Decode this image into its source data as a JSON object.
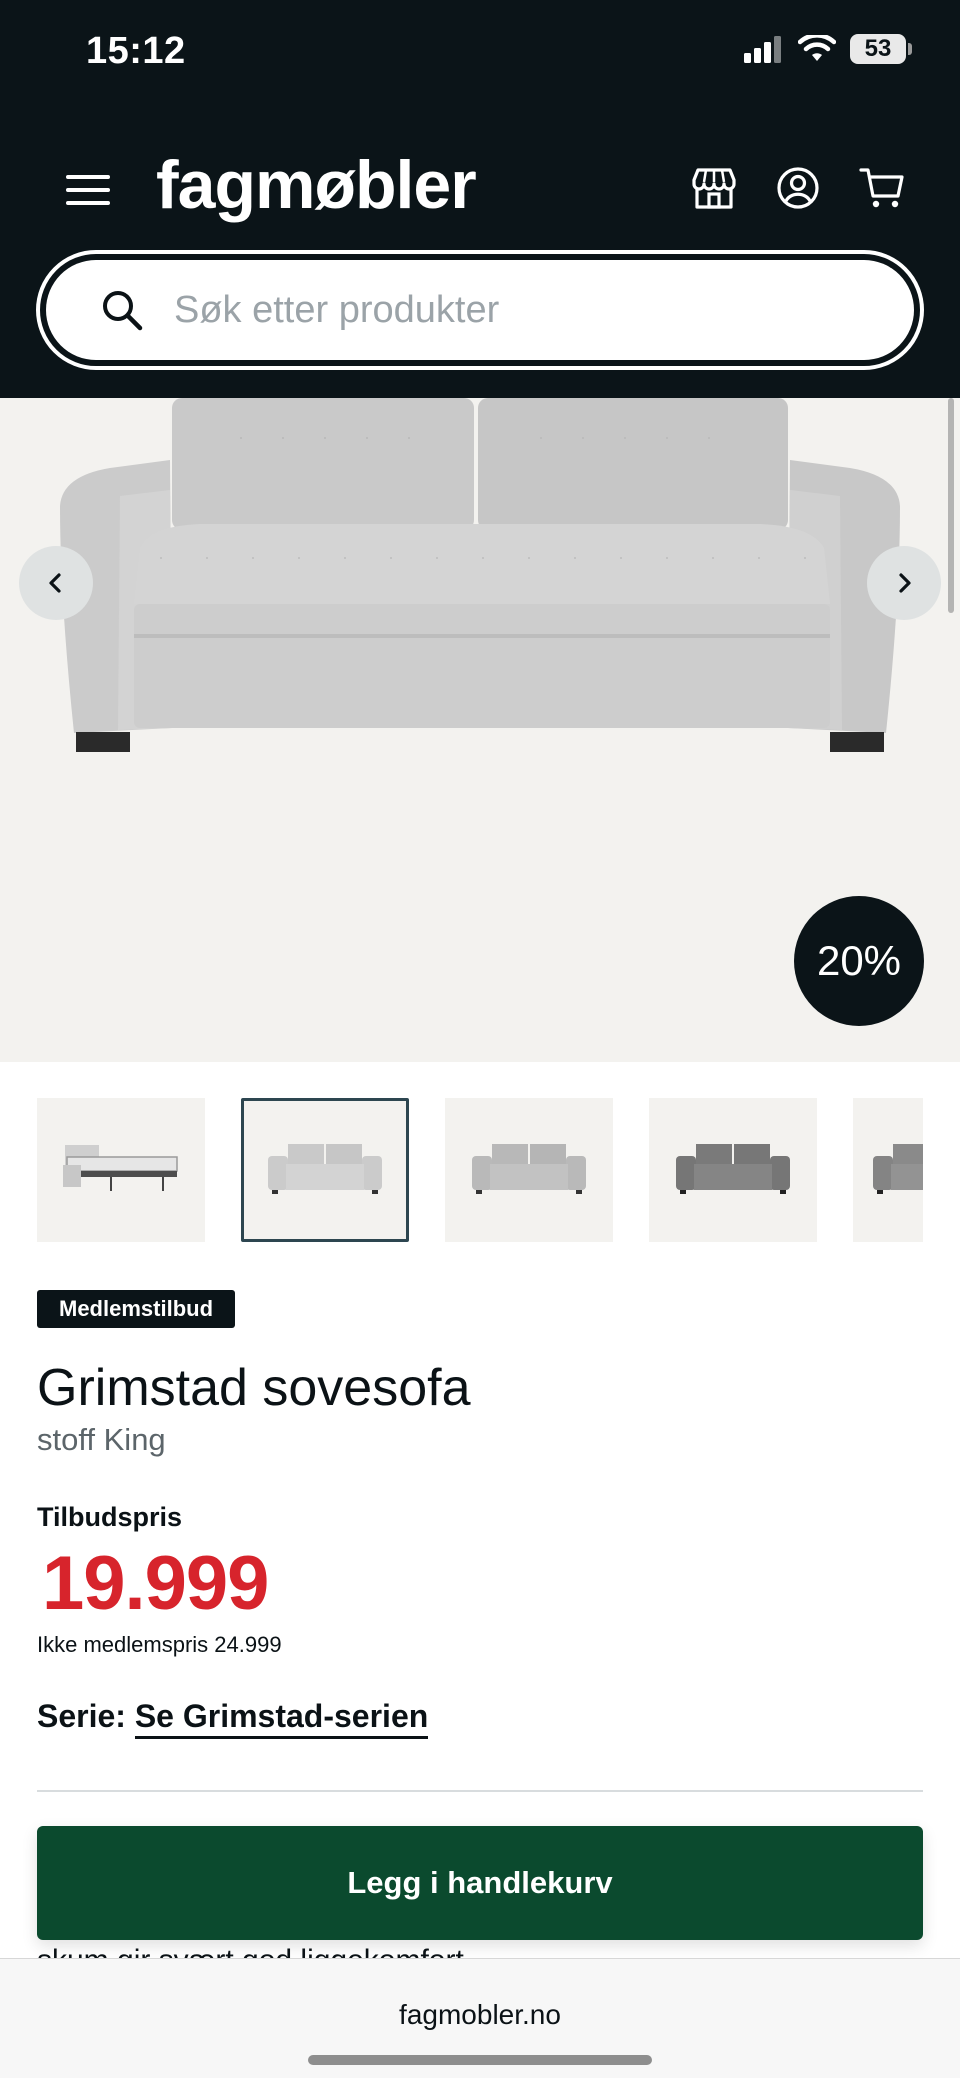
{
  "status": {
    "time": "15:12",
    "battery": "53",
    "icons": [
      "signal-icon",
      "wifi-icon",
      "battery-icon"
    ]
  },
  "header": {
    "logo": "fagmøbler",
    "icons": [
      "menu-icon",
      "store-icon",
      "account-icon",
      "cart-icon"
    ],
    "search": {
      "placeholder": "Søk etter produkter",
      "value": ""
    }
  },
  "hero": {
    "discount": "20%",
    "icons": [
      "chevron-left-icon",
      "chevron-right-icon"
    ]
  },
  "thumbnails": {
    "count": 5,
    "active_index": 1
  },
  "product": {
    "badge": "Medlemstilbud",
    "title": "Grimstad sovesofa",
    "subtitle": "stoff King",
    "price_label": "Tilbudspris",
    "price": "19.999",
    "nonmember": "Ikke medlemspris 24.999",
    "series_label": "Serie:",
    "series_link": "Se Grimstad-serien",
    "cut_text": "skum gir svært god liggekomfort"
  },
  "cta": {
    "label": "Legg i handlekurv"
  },
  "browser": {
    "url": "fagmobler.no"
  },
  "colors": {
    "header_bg": "#0b1418",
    "price": "#d7242c",
    "cta_bg": "#0b4a2e",
    "hero_bg": "#f3f2ef"
  }
}
